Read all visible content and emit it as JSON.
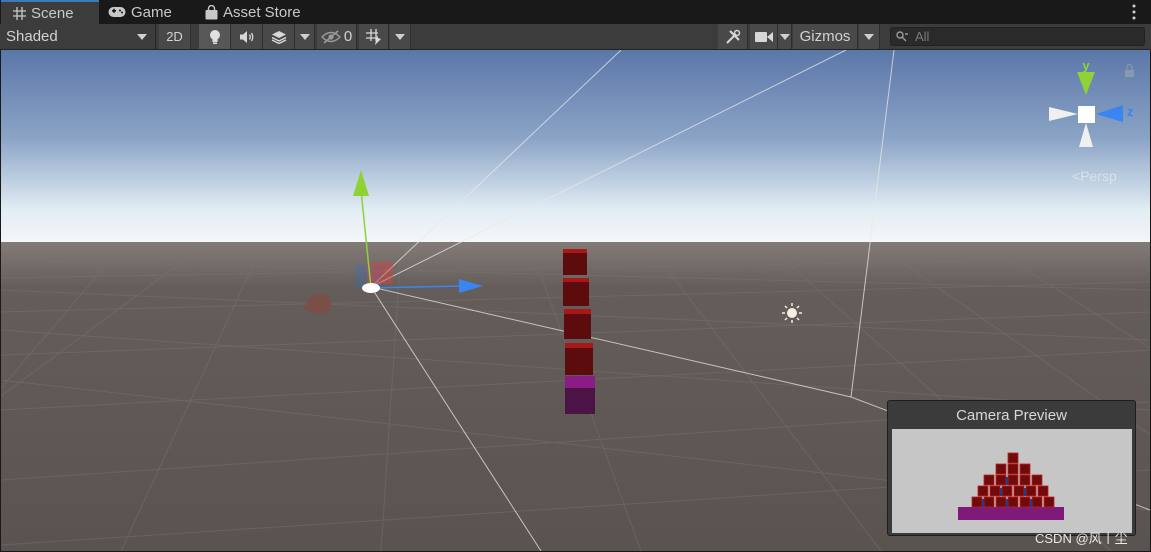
{
  "tabs": [
    {
      "label": "Scene",
      "icon": "grid-icon",
      "active": true
    },
    {
      "label": "Game",
      "icon": "gamepad-icon",
      "active": false
    },
    {
      "label": "Asset Store",
      "icon": "shopping-bag-icon",
      "active": false
    }
  ],
  "toolbar": {
    "draw_mode": "Shaded",
    "mode_2d": "2D",
    "hidden_count": "0",
    "gizmos_label": "Gizmos"
  },
  "search": {
    "placeholder": "All"
  },
  "scene_gizmo": {
    "y_axis": "y",
    "z_axis": "z",
    "projection": "Persp",
    "colors": {
      "y": "#8ed235",
      "z": "#3a86f0",
      "x": "#ffffff"
    }
  },
  "camera_preview": {
    "title": "Camera Preview"
  },
  "watermark": "CSDN @风丨尘",
  "colors": {
    "tab_accent": "#3a79bb",
    "ground": "#5d5652",
    "cube_red": "#5c0c0c",
    "cube_purple": "#4c1446",
    "preview_bg": "#c6c6c6"
  },
  "icons": [
    "grid-icon",
    "gamepad-icon",
    "shopping-bag-icon",
    "kebab-menu-icon",
    "light-bulb-icon",
    "audio-icon",
    "effects-icon",
    "visibility-icon",
    "grid-snap-icon",
    "tools-icon",
    "camera-icon",
    "search-icon",
    "lock-icon",
    "sun-icon"
  ]
}
